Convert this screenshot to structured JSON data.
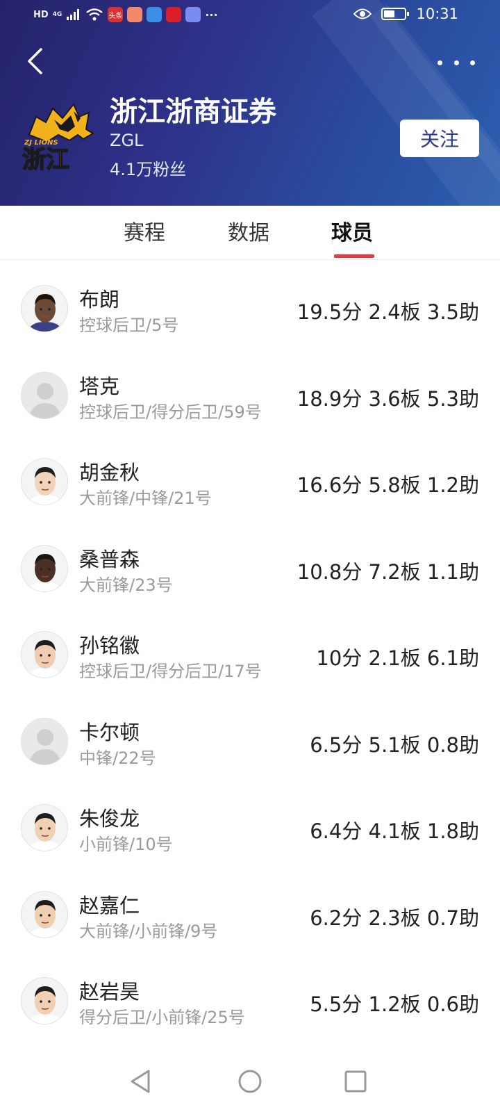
{
  "status_bar": {
    "network_label": "HD",
    "signal_label": "4G",
    "apps": [
      {
        "icon": "toutiao-icon",
        "label": "头条",
        "color": "#d93030"
      },
      {
        "icon": "orange-app-icon",
        "label": "",
        "color": "#f08a6a"
      },
      {
        "icon": "cloud-icon",
        "label": "",
        "color": "#3a8ee6"
      },
      {
        "icon": "heart-app-icon",
        "label": "",
        "color": "#d8202a"
      },
      {
        "icon": "music-icon",
        "label": "",
        "color": "#7b8cf0"
      }
    ],
    "overflow": "···",
    "battery_level": 0.55,
    "time": "10:31"
  },
  "header": {
    "team_name": "浙江浙商证券",
    "league": "ZGL",
    "fans": "4.1万粉丝",
    "follow_label": "关注",
    "logo_text": "浙江",
    "logo_subtext": "ZJ LIONS",
    "colors": {
      "accent": "#e23b45",
      "header_start": "#25236a",
      "header_end": "#2c5fb0"
    }
  },
  "tabs": [
    {
      "label": "赛程",
      "active": false
    },
    {
      "label": "数据",
      "active": false
    },
    {
      "label": "球员",
      "active": true
    }
  ],
  "players": [
    {
      "name": "布朗",
      "position": "控球后卫/5号",
      "stats": "19.5分 2.4板 3.5助",
      "avatar": "photo"
    },
    {
      "name": "塔克",
      "position": "控球后卫/得分后卫/59号",
      "stats": "18.9分 3.6板 5.3助",
      "avatar": "placeholder"
    },
    {
      "name": "胡金秋",
      "position": "大前锋/中锋/21号",
      "stats": "16.6分 5.8板 1.2助",
      "avatar": "photo"
    },
    {
      "name": "桑普森",
      "position": "大前锋/23号",
      "stats": "10.8分 7.2板 1.1助",
      "avatar": "photo"
    },
    {
      "name": "孙铭徽",
      "position": "控球后卫/得分后卫/17号",
      "stats": "10分 2.1板 6.1助",
      "avatar": "photo"
    },
    {
      "name": "卡尔顿",
      "position": "中锋/22号",
      "stats": "6.5分 5.1板 0.8助",
      "avatar": "placeholder"
    },
    {
      "name": "朱俊龙",
      "position": "小前锋/10号",
      "stats": "6.4分 4.1板 1.8助",
      "avatar": "photo"
    },
    {
      "name": "赵嘉仁",
      "position": "大前锋/小前锋/9号",
      "stats": "6.2分 2.3板 0.7助",
      "avatar": "photo"
    },
    {
      "name": "赵岩昊",
      "position": "得分后卫/小前锋/25号",
      "stats": "5.5分 1.2板 0.6助",
      "avatar": "photo"
    }
  ]
}
